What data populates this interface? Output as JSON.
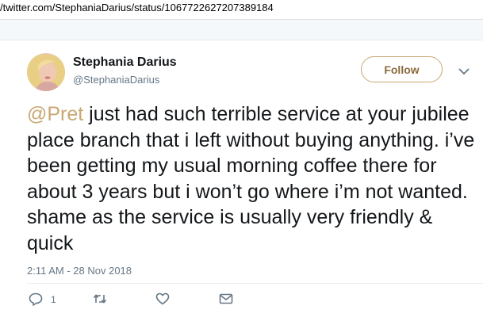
{
  "browser": {
    "url": "/twitter.com/StephaniaDarius/status/1067722627207389184"
  },
  "tweet": {
    "author_name": "Stephania Darius",
    "author_handle": "@StephaniaDarius",
    "follow_label": "Follow",
    "mention": "@Pret",
    "body": " just had such terrible service at your jubilee place branch that i left without buying anything. i’ve been getting my usual morning coffee there for about 3 years but i won’t go where i’m not wanted. shame as the service is usually very friendly & quick",
    "timestamp": "2:11 AM - 28 Nov 2018",
    "reply_count": "1"
  },
  "colors": {
    "accent": "#c9a873",
    "text": "#14171a",
    "secondary": "#657786"
  },
  "icons": [
    "chevron-down-icon",
    "reply-icon",
    "retweet-icon",
    "like-icon",
    "direct-message-icon"
  ]
}
